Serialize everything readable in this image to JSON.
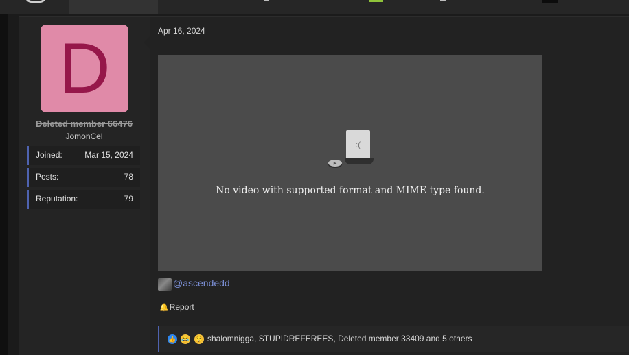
{
  "post": {
    "date": "Apr 16, 2024"
  },
  "user": {
    "avatar_letter": "D",
    "name": "Deleted member 66476",
    "title": "JomonCel",
    "stats": [
      {
        "label": "Joined:",
        "value": "Mar 15, 2024"
      },
      {
        "label": "Posts:",
        "value": "78"
      },
      {
        "label": "Reputation:",
        "value": "79"
      }
    ]
  },
  "video": {
    "error_message": "No video with supported format and MIME type found."
  },
  "mention": {
    "text": "@ascendedd"
  },
  "actions": {
    "report_label": "Report"
  },
  "reactions": {
    "summary": "shalomnigga, STUPIDREFEREES, Deleted member 33409 and 5 others",
    "icons": [
      "like-icon",
      "haha-icon",
      "wow-icon"
    ]
  },
  "colors": {
    "accent": "#4f63b0",
    "link": "#7b8fd6",
    "avatar_bg": "#e08aa8",
    "avatar_fg": "#96174a",
    "nav_green": "#8fc33a"
  }
}
